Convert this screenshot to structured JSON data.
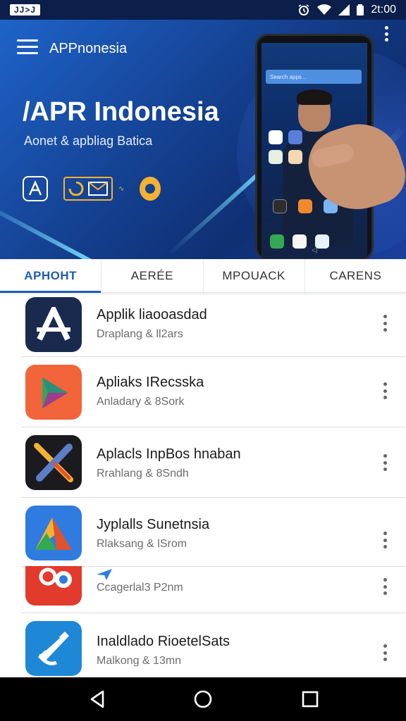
{
  "status_bar": {
    "left_badge": "JJ>J",
    "time": "2t:00"
  },
  "header": {
    "app_title": "APPnonesia",
    "hero_title": "/APR Indonesia",
    "hero_subtitle": "Aonet & apbliag Batica",
    "badge_small": "∿"
  },
  "phone_mock": {
    "search_placeholder": "Search apps..."
  },
  "tabs": [
    {
      "label": "APHOHT",
      "active": true
    },
    {
      "label": "AERÉE",
      "active": false
    },
    {
      "label": "MPOUACK",
      "active": false
    },
    {
      "label": "CARENS",
      "active": false
    }
  ],
  "apps": [
    {
      "title": "Applik liaooasdad",
      "subtitle": "Draplang & ll2ars",
      "icon": "letter-a-icon"
    },
    {
      "title": "Apliaks IRecsska",
      "subtitle": "Anladary & 8Sork",
      "icon": "play-triangle-icon"
    },
    {
      "title": "Aplacls InpBos hnaban",
      "subtitle": "Rrahlang & 8Sndh",
      "icon": "tools-icon"
    },
    {
      "title": "Jyplalls Sunetnsia",
      "subtitle": "Rlaksang & lSrom",
      "icon": "maps-icon"
    },
    {
      "title": "",
      "subtitle": "Ccagerlal3 P2nm",
      "icon": "location-pin-icon"
    },
    {
      "title": "Inaldlado RioetelSats",
      "subtitle": "Malkong & 13mn",
      "icon": "paper-plane-icon"
    }
  ],
  "colors": {
    "accent": "#1d5bb8",
    "hero_dark": "#0f2f73",
    "hero_light": "#1e63c9",
    "badge_gold": "#f3b234"
  }
}
